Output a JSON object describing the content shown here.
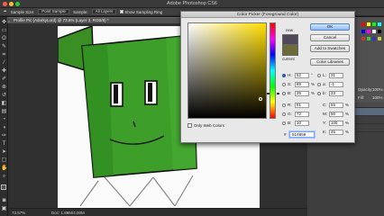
{
  "window": {
    "title": "Adobe Photoshop CS6",
    "traffic_lights": [
      "#ff5f57",
      "#febc2e",
      "#28c840"
    ]
  },
  "options_bar": {
    "sample_size_label": "Sample Size:",
    "sample_size_value": "Point Sample",
    "sample_label": "Sample:",
    "sample_value": "All Layers",
    "show_ring_label": "Show Sampling Ring"
  },
  "document_tab": {
    "label": "Profile Pic (AdorkyLord) @ 73.6% (Layer 3, RGB/8) *"
  },
  "status_bar": {
    "zoom": "73.57%",
    "doc_info": "Doc: 1.89M/4.00M"
  },
  "right_panel": {
    "opacity_label": "Opacity:",
    "opacity_value": "100%",
    "fill_label": "Fill:",
    "fill_value": "100%",
    "layers": [
      "Layer 3",
      "Layer 2",
      "Color Overlay"
    ]
  },
  "color_picker": {
    "title": "Color Picker (Foreground Color)",
    "ok_label": "OK",
    "cancel_label": "Cancel",
    "add_swatches_label": "Add to Swatches",
    "color_libraries_label": "Color Libraries",
    "new_label": "new",
    "current_label": "current",
    "only_web_colors_label": "Only Web Colors",
    "hex_label": "#",
    "hex_value": "514859",
    "colors": {
      "new": "#514859",
      "current": "#6b6b3a"
    },
    "fields_left": [
      {
        "label": "H:",
        "value": "52",
        "unit": "°",
        "selected": true
      },
      {
        "label": "S:",
        "value": "89",
        "unit": "%",
        "selected": false
      },
      {
        "label": "B:",
        "value": "35",
        "unit": "%",
        "selected": false
      },
      {
        "label": "R:",
        "value": "81",
        "unit": "",
        "selected": false
      },
      {
        "label": "G:",
        "value": "72",
        "unit": "",
        "selected": false
      },
      {
        "label": "B:",
        "value": "10",
        "unit": "",
        "selected": false
      }
    ],
    "fields_right": [
      {
        "label": "L:",
        "value": "31",
        "unit": ""
      },
      {
        "label": "a:",
        "value": "-1",
        "unit": ""
      },
      {
        "label": "b:",
        "value": "33",
        "unit": ""
      },
      {
        "label": "C:",
        "value": "56",
        "unit": "%"
      },
      {
        "label": "M:",
        "value": "50",
        "unit": "%"
      },
      {
        "label": "Y:",
        "value": "100",
        "unit": "%"
      },
      {
        "label": "K:",
        "value": "46",
        "unit": "%"
      }
    ]
  }
}
